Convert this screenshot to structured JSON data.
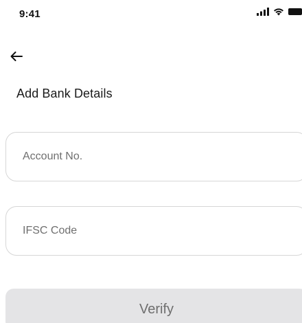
{
  "status_bar": {
    "time": "9:41",
    "icons": [
      "signal-icon",
      "wifi-icon",
      "battery-icon"
    ]
  },
  "nav": {
    "back_icon": "arrow-left-icon"
  },
  "page": {
    "title": "Add Bank Details"
  },
  "form": {
    "account_no": {
      "placeholder": "Account No.",
      "value": ""
    },
    "ifsc_code": {
      "placeholder": "IFSC Code",
      "value": ""
    },
    "verify_label": "Verify"
  },
  "colors": {
    "field_border": "#d6d6d6",
    "button_bg": "#e4e4e6",
    "button_text": "#6e6e6e",
    "text": "#1a1a1a"
  }
}
